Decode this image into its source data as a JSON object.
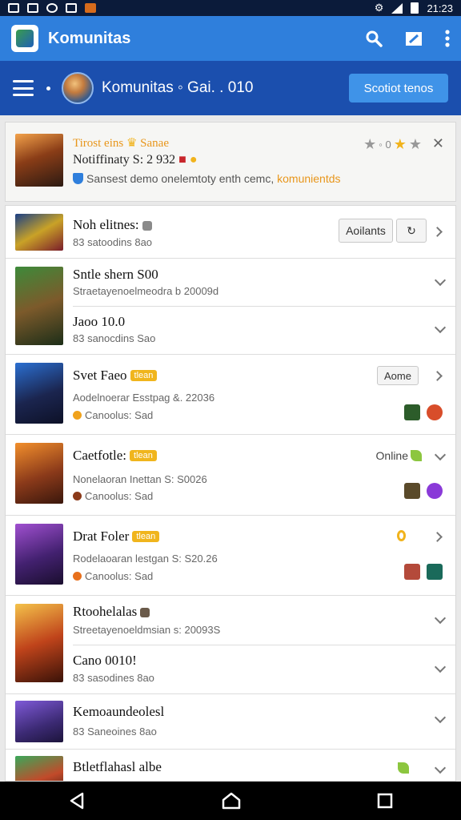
{
  "status_bar": {
    "time": "21:23"
  },
  "app_bar": {
    "title": "Komunitas",
    "icons": [
      "search-icon",
      "edit-icon",
      "more-vert-icon"
    ]
  },
  "sub_bar": {
    "title": "Komunitas ◦ Gai. . 010",
    "button_label": "Scotiot tenos"
  },
  "featured": {
    "title": "Tirost eins",
    "title_badge": "Sanae",
    "subtitle": "Notiffinaty S: 2 932",
    "description": "Sansest demo onelemtoty enth cemc,",
    "description_highlight": "komunientds",
    "rating_text": "◦ 0",
    "icons": [
      "star-icon",
      "close-icon"
    ]
  },
  "list": [
    {
      "name": "Noh elitnes:",
      "meta": "83 satoodins 8ao",
      "action": "Aoilants",
      "thumb": "t2"
    },
    {
      "name": "Sntle shern S00",
      "meta": "Straetayenoelmeodra b 20009d",
      "thumb": "t3"
    },
    {
      "name": "Jaoo 10.0",
      "meta": "83 sanocdins Sao"
    },
    {
      "name": "Svet Faeo",
      "badge": "tlean",
      "meta": "Aodelnoerar Esstpag &. 22036",
      "meta2": "Canoolus: Sad",
      "action": "Aome",
      "thumb": "t4"
    },
    {
      "name": "Caetfotle:",
      "badge": "tlean",
      "meta": "Nonelaoran Inettan S: S0026",
      "meta2": "Canoolus: Sad",
      "status": "Online",
      "thumb": "t5"
    },
    {
      "name": "Drat Foler",
      "badge": "tlean",
      "meta": "Rodelaoaran lestgan S: S20.26",
      "meta2": "Canoolus: Sad",
      "thumb": "t6"
    },
    {
      "name": "Rtoohelalas",
      "meta": "Streetayenoeldmsian s: 20093S",
      "thumb": "t7"
    },
    {
      "name": "Cano 0010!",
      "meta": "83 sasodines 8ao"
    },
    {
      "name": "Kemoaundeolesl",
      "meta": "83 Saneoines 8ao",
      "thumb": "t8"
    },
    {
      "name": "Btletflahasl albe",
      "thumb": "t9"
    }
  ],
  "colors": {
    "app_bar": "#2f7fdc",
    "sub_bar": "#1b4fae",
    "accent": "#f0b51d",
    "button": "#3f93e8"
  }
}
